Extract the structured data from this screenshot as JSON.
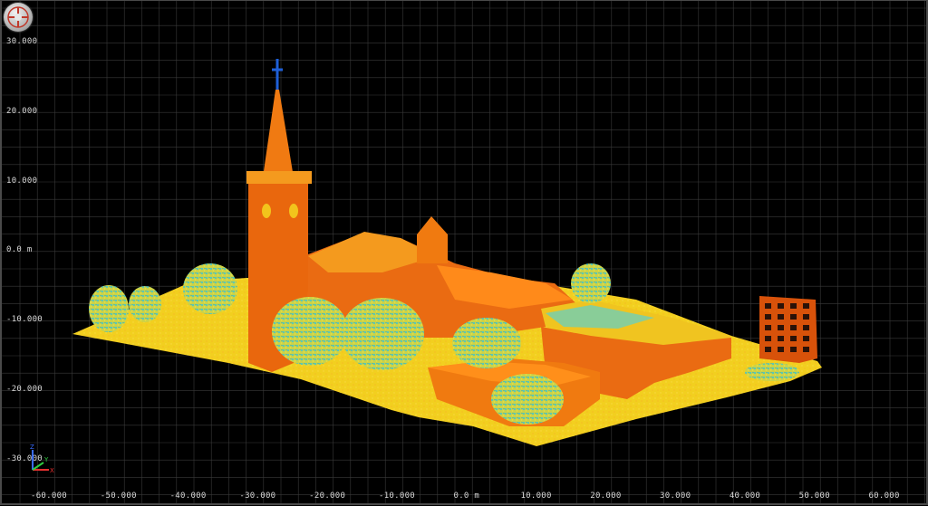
{
  "viewer": {
    "logo_icon": "app-logo-icon",
    "axis_icon": "xyz-axis-gizmo-icon",
    "axis_letters": {
      "x": "X",
      "y": "Y",
      "z": "Z"
    },
    "colors": {
      "background": "#000000",
      "grid": "#3a3a3a",
      "label": "#d9d9d9",
      "points_ground": "#f2d41c",
      "points_building": "#f07a10",
      "points_roof": "#e85d0a",
      "points_vegetation": "#48c9c0",
      "points_high": "#1e5fd8"
    }
  },
  "y_axis": {
    "ticks": [
      "30.000",
      "20.000",
      "10.000",
      "0.0 m",
      "-10.000",
      "-20.000",
      "-30.000"
    ]
  },
  "x_axis": {
    "ticks": [
      "-60.000",
      "-50.000",
      "-40.000",
      "-30.000",
      "-20.000",
      "-10.000",
      "0.0 m",
      "10.000",
      "20.000",
      "30.000",
      "40.000",
      "50.000",
      "60.000"
    ]
  }
}
